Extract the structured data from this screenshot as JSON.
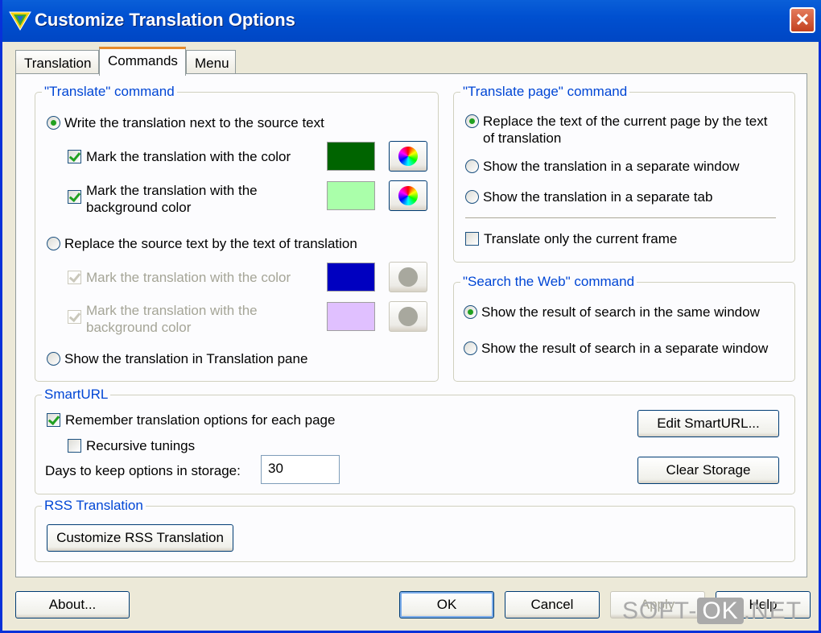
{
  "window": {
    "title": "Customize Translation Options",
    "close_label": "✕"
  },
  "tabs": [
    {
      "label": "Translation"
    },
    {
      "label": "Commands",
      "active": true
    },
    {
      "label": "Menu"
    }
  ],
  "translate_command": {
    "legend": "\"Translate\" command",
    "opt_next": "Write the translation next to the source text",
    "mark_color": "Mark the translation with the color",
    "mark_bg_1": "Mark the translation with the",
    "mark_bg_2": "background color",
    "opt_replace": "Replace the source text by the text of translation",
    "mark_color_dis": "Mark the translation with the color",
    "mark_bg_dis_1": "Mark the translation with the",
    "mark_bg_dis_2": "background color",
    "opt_pane": "Show the translation in Translation pane",
    "colors": {
      "mark": "#006400",
      "bg": "#aaffaa",
      "mark_dis": "#0000c0",
      "bg_dis": "#e0c0ff"
    }
  },
  "translate_page_command": {
    "legend": "\"Translate page\" command",
    "opt_replace_1": "Replace the text of the current page by the text",
    "opt_replace_2": "of translation",
    "opt_window": "Show the translation in a separate window",
    "opt_tab": "Show the translation in a separate tab",
    "only_frame": "Translate only the current frame"
  },
  "search_command": {
    "legend": "\"Search the Web\" command",
    "opt_same": "Show the result of search in the same window",
    "opt_separate": "Show the result of search in a separate window"
  },
  "smarturl": {
    "legend": "SmartURL",
    "remember": "Remember translation options for each page",
    "recursive": "Recursive tunings",
    "days_label": "Days to keep options in storage:",
    "days_value": "30",
    "edit_btn": "Edit SmartURL...",
    "clear_btn": "Clear Storage"
  },
  "rss": {
    "legend": "RSS Translation",
    "customize_btn": "Customize RSS Translation"
  },
  "footer": {
    "about_btn": "About...",
    "ok_btn": "OK",
    "cancel_btn": "Cancel",
    "apply_btn": "Apply",
    "help_btn": "Help"
  },
  "watermark": {
    "left": "SOFT-",
    "ok": "OK",
    "right": ".NET"
  }
}
